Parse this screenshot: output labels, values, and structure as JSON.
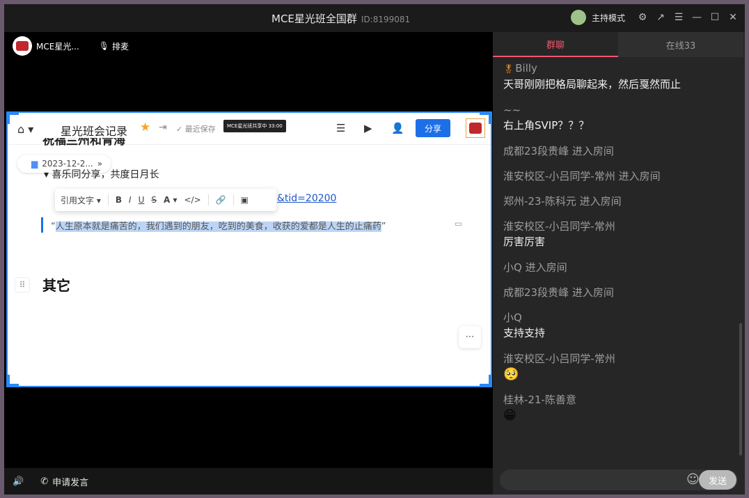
{
  "window": {
    "title": "MCE星光班全国群",
    "id_label": "ID:8199081",
    "host_mode": "主持模式"
  },
  "stage": {
    "room_name": "MCE星光...",
    "mic_label": "排麦"
  },
  "doc": {
    "title": "星光班会记录",
    "saved_label": "最近保存",
    "share_tag": "MCE星光班共享中 33:00",
    "share_button": "分享",
    "heading_cut": "祝福兰州和青海",
    "date_chip": "2023-12-2...",
    "bullet": "喜乐同分享，共度日月长",
    "format_style": "引用文字",
    "link_text": "&tid=20200",
    "quote_open": "“",
    "quote_text": "人生原本就是痛苦的，我们遇到的朋友，吃到的美食，收获的爱都是人生的止痛药",
    "quote_close": "”",
    "heading_other": "其它"
  },
  "bottom": {
    "request_speak": "申请发言"
  },
  "chat": {
    "tabs": [
      {
        "label": "群聊",
        "active": true
      },
      {
        "label": "在线33",
        "active": false
      }
    ],
    "messages": [
      {
        "sender": "Billy",
        "text": "天哥刚刚把格局聊起来，然后戛然而止",
        "has_badge": true
      },
      {
        "sender": "~~",
        "text": "右上角SVIP？？？"
      },
      {
        "sender": "成都23段贵峰 进入房间",
        "text": ""
      },
      {
        "sender": "淮安校区-小吕同学-常州 进入房间",
        "text": ""
      },
      {
        "sender": "郑州-23-陈科元 进入房间",
        "text": ""
      },
      {
        "sender": "淮安校区-小吕同学-常州",
        "text": "厉害厉害"
      },
      {
        "sender": "小Q 进入房间",
        "text": ""
      },
      {
        "sender": "成都23段贵峰 进入房间",
        "text": ""
      },
      {
        "sender": "小Q",
        "text": "支持支持"
      },
      {
        "sender": "淮安校区-小吕同学-常州",
        "text": "",
        "emoji": "🥺"
      },
      {
        "sender": "桂林-21-陈善意",
        "text": "",
        "emoji": "😁"
      }
    ],
    "send_label": "发送"
  },
  "colors": {
    "accent_tab": "#f2566e",
    "share_blue": "#1d6fe8",
    "star": "#f5a623"
  }
}
